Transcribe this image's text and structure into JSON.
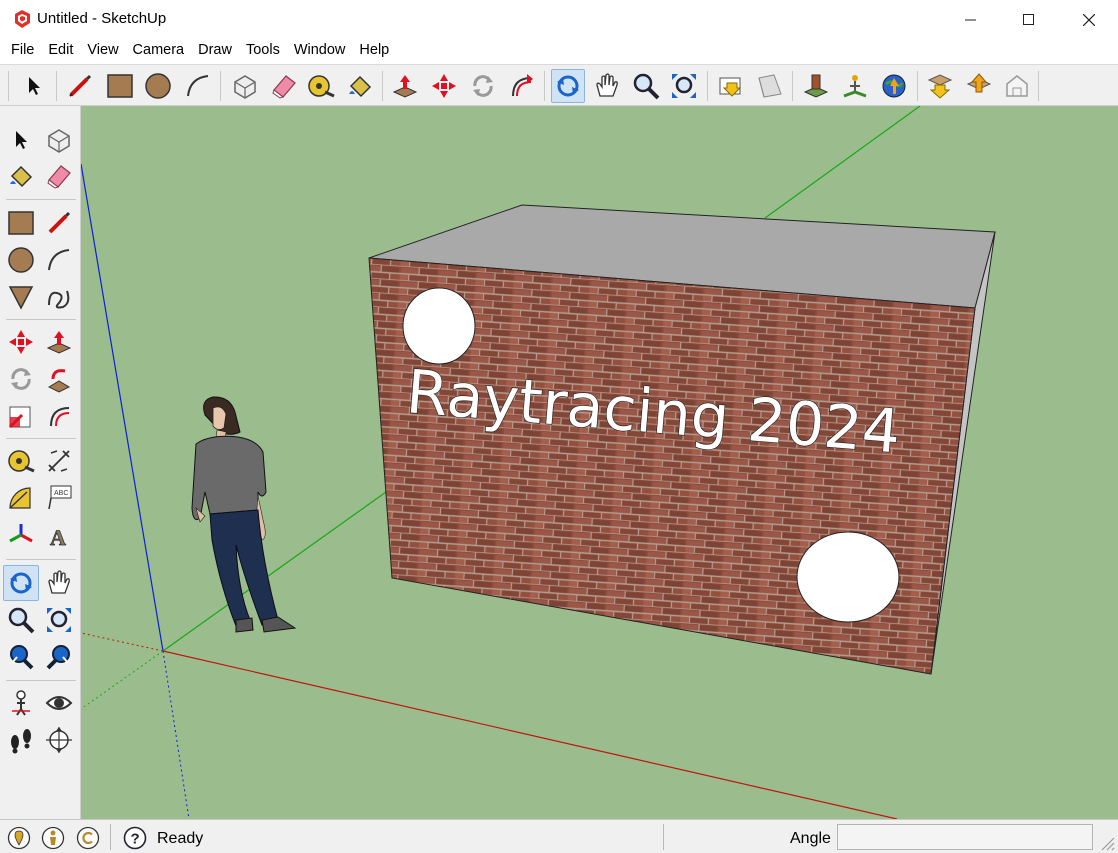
{
  "window": {
    "title": "Untitled - SketchUp",
    "minimize": "—",
    "maximize": "☐",
    "close": "✕"
  },
  "menu": [
    "File",
    "Edit",
    "View",
    "Camera",
    "Draw",
    "Tools",
    "Window",
    "Help"
  ],
  "toolbar": {
    "icons": [
      "select-icon",
      "pencil-line-icon",
      "rectangle-icon",
      "circle-icon",
      "arc-icon",
      "make-component-icon",
      "eraser-icon",
      "tape-measure-icon",
      "paint-bucket-icon",
      "push-pull-icon",
      "move-icon",
      "rotate-icon",
      "follow-me-icon",
      "orbit-icon",
      "pan-icon",
      "zoom-icon",
      "zoom-extents-icon",
      "get-models-icon",
      "share-model-icon",
      "add-location-icon",
      "toggle-terrain-icon",
      "preview-google-earth-icon",
      "get-models-3d-icon",
      "share-component-icon",
      "extension-warehouse-icon"
    ]
  },
  "scene": {
    "wall_text": "Raytracing 2024",
    "colors": {
      "ground": "#9bbd8e",
      "box_top": "#a9a9a9",
      "brick": "#8a4a3c",
      "red_axis": "#c0150e",
      "green_axis": "#15a815",
      "blue_axis": "#0b1fd9"
    }
  },
  "status": {
    "text": "Ready",
    "measurements_label": "Angle",
    "measurements_value": ""
  }
}
